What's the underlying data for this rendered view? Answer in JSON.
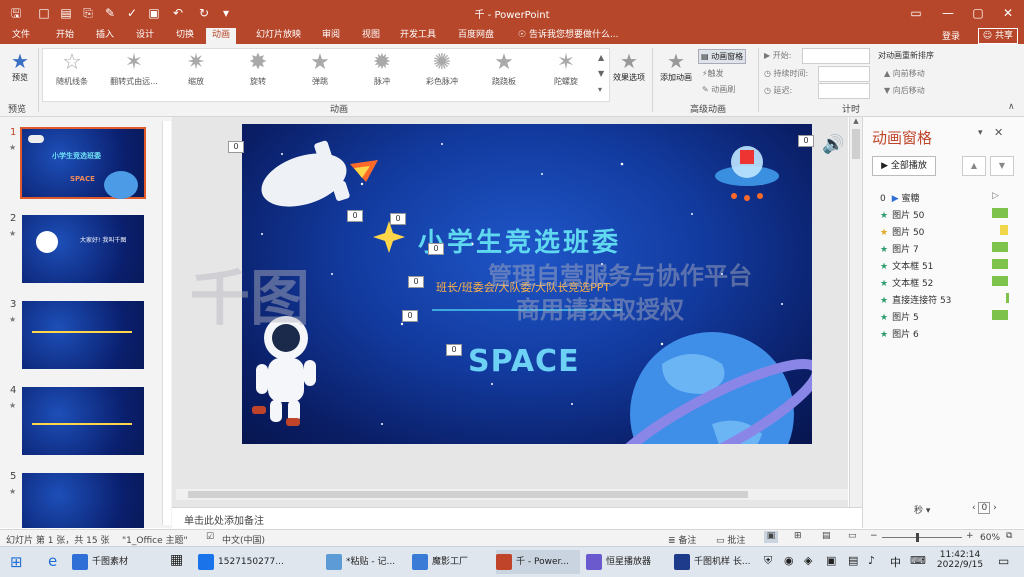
{
  "window": {
    "title": "千 - PowerPoint",
    "login": "登录",
    "share": "共享"
  },
  "tabs": [
    "文件",
    "开始",
    "插入",
    "设计",
    "切换",
    "动画",
    "幻灯片放映",
    "审阅",
    "视图",
    "开发工具",
    "百度网盘"
  ],
  "tell_me": "告诉我您想要做什么...",
  "ribbon": {
    "preview": "预览",
    "preview_group": "预览",
    "effects": [
      "随机线条",
      "翻转式由远...",
      "缩放",
      "旋转",
      "弹跳",
      "脉冲",
      "彩色脉冲",
      "跷跷板",
      "陀螺旋"
    ],
    "anim_group": "动画",
    "effect_options": "效果选项",
    "add_animation": "添加动画",
    "anim_pane_btn": "动画窗格",
    "trigger": "触发",
    "anim_painter": "动画刷",
    "advanced_group": "高级动画",
    "start_label": "开始:",
    "duration_label": "持续时间:",
    "delay_label": "延迟:",
    "timing_group": "计时",
    "reorder_title": "对动画重新排序",
    "move_earlier": "向前移动",
    "move_later": "向后移动"
  },
  "thumbnails": [
    {
      "num": "1",
      "title": "小学生竞选班委",
      "sub": "SPACE"
    },
    {
      "num": "2",
      "title": "大家好! 我叫千图",
      "sub": ""
    },
    {
      "num": "3",
      "title": "",
      "sub": ""
    },
    {
      "num": "4",
      "title": "",
      "sub": ""
    },
    {
      "num": "5",
      "title": "",
      "sub": ""
    }
  ],
  "slide": {
    "title": "小学生竞选班委",
    "subtitle": "班长/班委会/大队委/大队长竞选PPT",
    "space": "SPACE",
    "anim_tag": "0"
  },
  "watermark": {
    "line1": "千图",
    "line2": "管理自营服务与协作平台",
    "line3": "商用请获取授权"
  },
  "anim_pane": {
    "title": "动画窗格",
    "play_all": "全部播放",
    "items": [
      {
        "num": "0",
        "name": "蜜糖",
        "icon": "play",
        "bar": "none"
      },
      {
        "num": "",
        "name": "图片 50",
        "icon": "green-star",
        "bar": "green"
      },
      {
        "num": "",
        "name": "图片 50",
        "icon": "yellow-star",
        "bar": "yellow"
      },
      {
        "num": "",
        "name": "图片 7",
        "icon": "green-star",
        "bar": "green"
      },
      {
        "num": "",
        "name": "文本框 51",
        "icon": "green-star",
        "bar": "green"
      },
      {
        "num": "",
        "name": "文本框 52",
        "icon": "green-star",
        "bar": "green"
      },
      {
        "num": "",
        "name": "直接连接符 53",
        "icon": "green-star",
        "bar": "green-thin"
      },
      {
        "num": "",
        "name": "图片 5",
        "icon": "green-star",
        "bar": "green"
      },
      {
        "num": "",
        "name": "图片 6",
        "icon": "green-star",
        "bar": "none"
      }
    ],
    "seconds": "秒",
    "page": "0"
  },
  "notes": {
    "placeholder": "单击此处添加备注"
  },
  "status": {
    "slide_info": "幻灯片 第 1 张，共 15 张",
    "theme": "\"1_Office 主题\"",
    "lang": "中文(中国)",
    "notes_btn": "备注",
    "comments_btn": "批注",
    "zoom": "60%"
  },
  "taskbar": {
    "apps": [
      {
        "label": "千图素材",
        "color": "#2f6fd6",
        "active": false
      },
      {
        "label": "1527150277...",
        "color": "#1a73e8",
        "active": false
      },
      {
        "label": "*粘贴 - 记...",
        "color": "#5c9bd6",
        "active": false
      },
      {
        "label": "魔影工厂",
        "color": "#3a7bd5",
        "active": false
      },
      {
        "label": "千 - Power...",
        "color": "#c0442a",
        "active": true
      },
      {
        "label": "恒星播放器",
        "color": "#6a5acd",
        "active": false
      },
      {
        "label": "千图机样 长...",
        "color": "#1e3a8a",
        "active": false
      }
    ],
    "ime": "中",
    "time": "11:42:14",
    "date": "2022/9/15"
  },
  "colors": {
    "brand": "#b7472a",
    "accent": "#c0442a",
    "slide_bg": "#123a9e",
    "title_cyan": "#5fd8f0"
  }
}
